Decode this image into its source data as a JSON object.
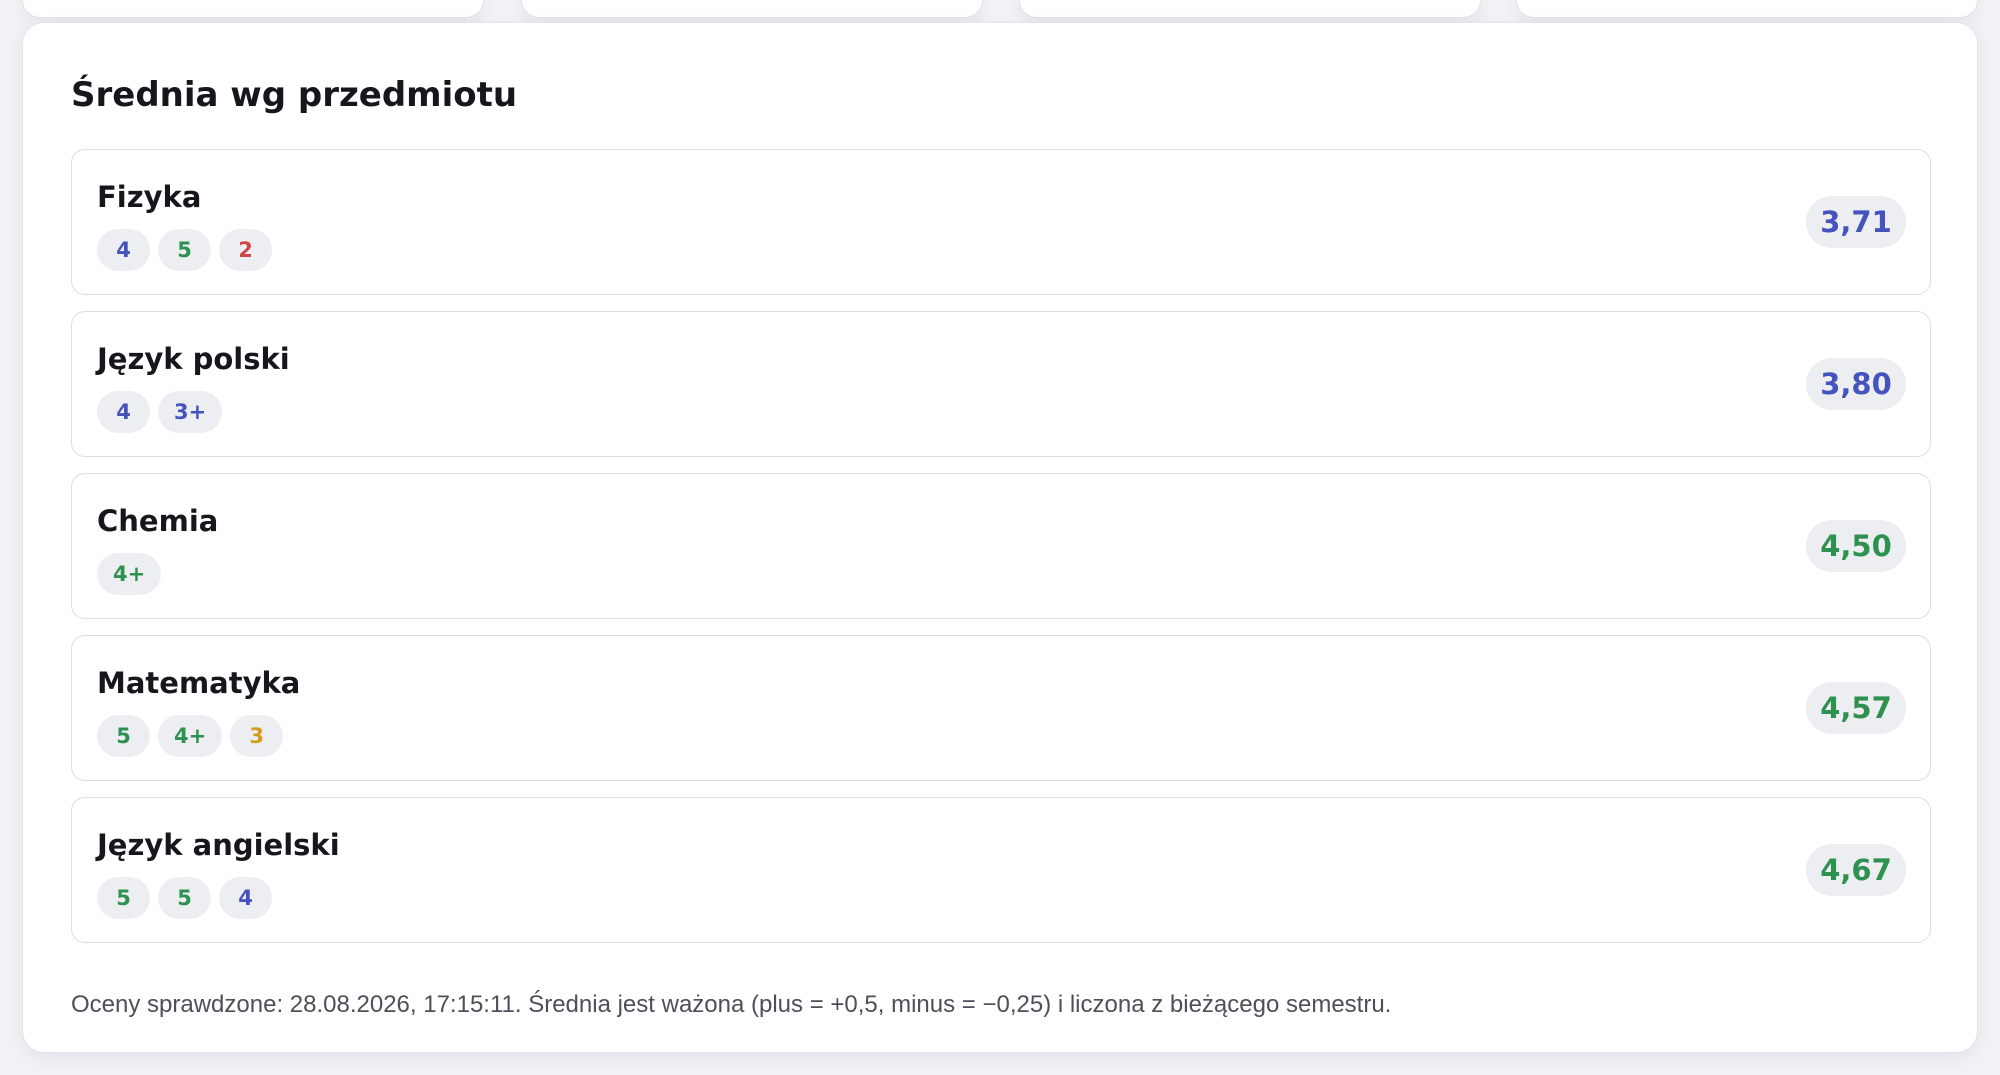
{
  "panel": {
    "title": "Średnia wg przedmiotu"
  },
  "subjects": [
    {
      "name": "Fizyka",
      "grades": [
        {
          "value": "4",
          "color": "blue"
        },
        {
          "value": "5",
          "color": "green"
        },
        {
          "value": "2",
          "color": "red"
        }
      ],
      "average": "3,71",
      "average_color": "blue"
    },
    {
      "name": "Język polski",
      "grades": [
        {
          "value": "4",
          "color": "blue"
        },
        {
          "value": "3+",
          "color": "blue"
        }
      ],
      "average": "3,80",
      "average_color": "blue"
    },
    {
      "name": "Chemia",
      "grades": [
        {
          "value": "4+",
          "color": "green"
        }
      ],
      "average": "4,50",
      "average_color": "green"
    },
    {
      "name": "Matematyka",
      "grades": [
        {
          "value": "5",
          "color": "green"
        },
        {
          "value": "4+",
          "color": "green"
        },
        {
          "value": "3",
          "color": "amber"
        }
      ],
      "average": "4,57",
      "average_color": "green"
    },
    {
      "name": "Język angielski",
      "grades": [
        {
          "value": "5",
          "color": "green"
        },
        {
          "value": "5",
          "color": "green"
        },
        {
          "value": "4",
          "color": "blue"
        }
      ],
      "average": "4,67",
      "average_color": "green"
    }
  ],
  "footnote": "Oceny sprawdzone: 28.08.2026, 17:15:11. Średnia jest ważona (plus = +0,5, minus = −0,25) i liczona z bieżącego semestru.",
  "colors": {
    "blue": "#4653bd",
    "green": "#2f9150",
    "red": "#cf4848",
    "amber": "#d79b1c"
  }
}
